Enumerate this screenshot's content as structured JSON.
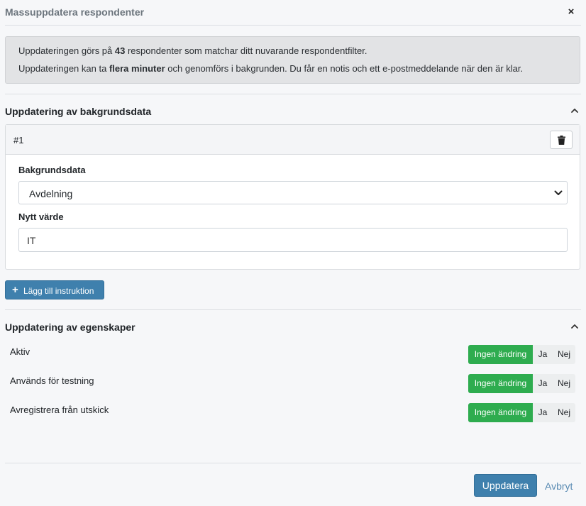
{
  "dialog": {
    "title": "Massuppdatera respondenter",
    "close_label": "×"
  },
  "info": {
    "line1_prefix": "Uppdateringen görs på ",
    "line1_count": "43",
    "line1_suffix": " respondenter som matchar ditt nuvarande respondentfilter.",
    "line2_prefix": "Uppdateringen kan ta ",
    "line2_emphasis": "flera minuter",
    "line2_suffix": " och genomförs i bakgrunden. Du får en notis och ett e-postmeddelande när den är klar."
  },
  "background_section": {
    "title": "Uppdatering av bakgrundsdata",
    "instructions": [
      {
        "number": "#1",
        "field_label": "Bakgrundsdata",
        "field_value": "Avdelning",
        "new_value_label": "Nytt värde",
        "new_value": "IT"
      }
    ],
    "add_button_label": "Lägg till instruktion"
  },
  "properties_section": {
    "title": "Uppdatering av egenskaper",
    "options": {
      "no_change": "Ingen ändring",
      "yes": "Ja",
      "no": "Nej"
    },
    "items": [
      {
        "label": "Aktiv",
        "selected": "no_change"
      },
      {
        "label": "Används för testning",
        "selected": "no_change"
      },
      {
        "label": "Avregistrera från utskick",
        "selected": "no_change"
      }
    ]
  },
  "footer": {
    "update_label": "Uppdatera",
    "cancel_label": "Avbryt"
  },
  "colors": {
    "primary": "#3f80ad",
    "success": "#2eac4f",
    "info_bg": "#e2e3e5"
  },
  "icons": [
    "close-icon",
    "chevron-up-icon",
    "trash-icon",
    "chevron-down-icon",
    "plus-icon"
  ]
}
